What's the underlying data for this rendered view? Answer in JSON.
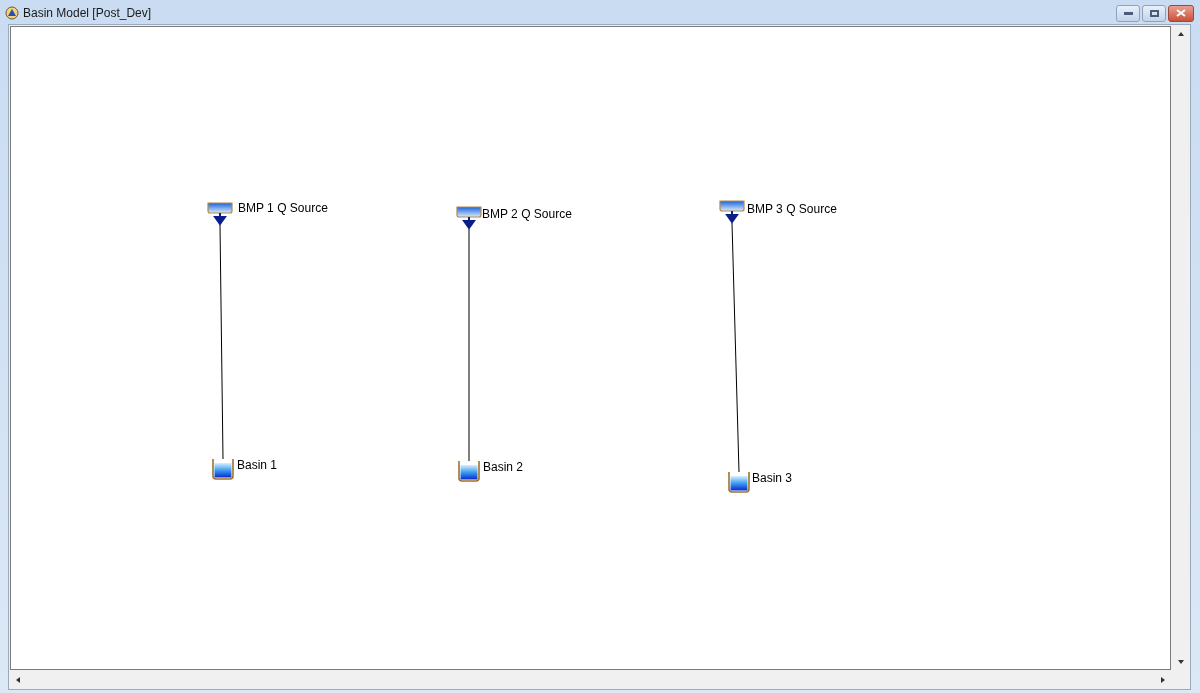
{
  "window": {
    "title": "Basin Model [Post_Dev]"
  },
  "elements": [
    {
      "kind": "source",
      "label": "BMP 1 Q Source"
    },
    {
      "kind": "source",
      "label": "BMP 2 Q Source"
    },
    {
      "kind": "source",
      "label": "BMP 3 Q Source"
    },
    {
      "kind": "basin",
      "label": "Basin 1"
    },
    {
      "kind": "basin",
      "label": "Basin 2"
    },
    {
      "kind": "basin",
      "label": "Basin 3"
    }
  ]
}
